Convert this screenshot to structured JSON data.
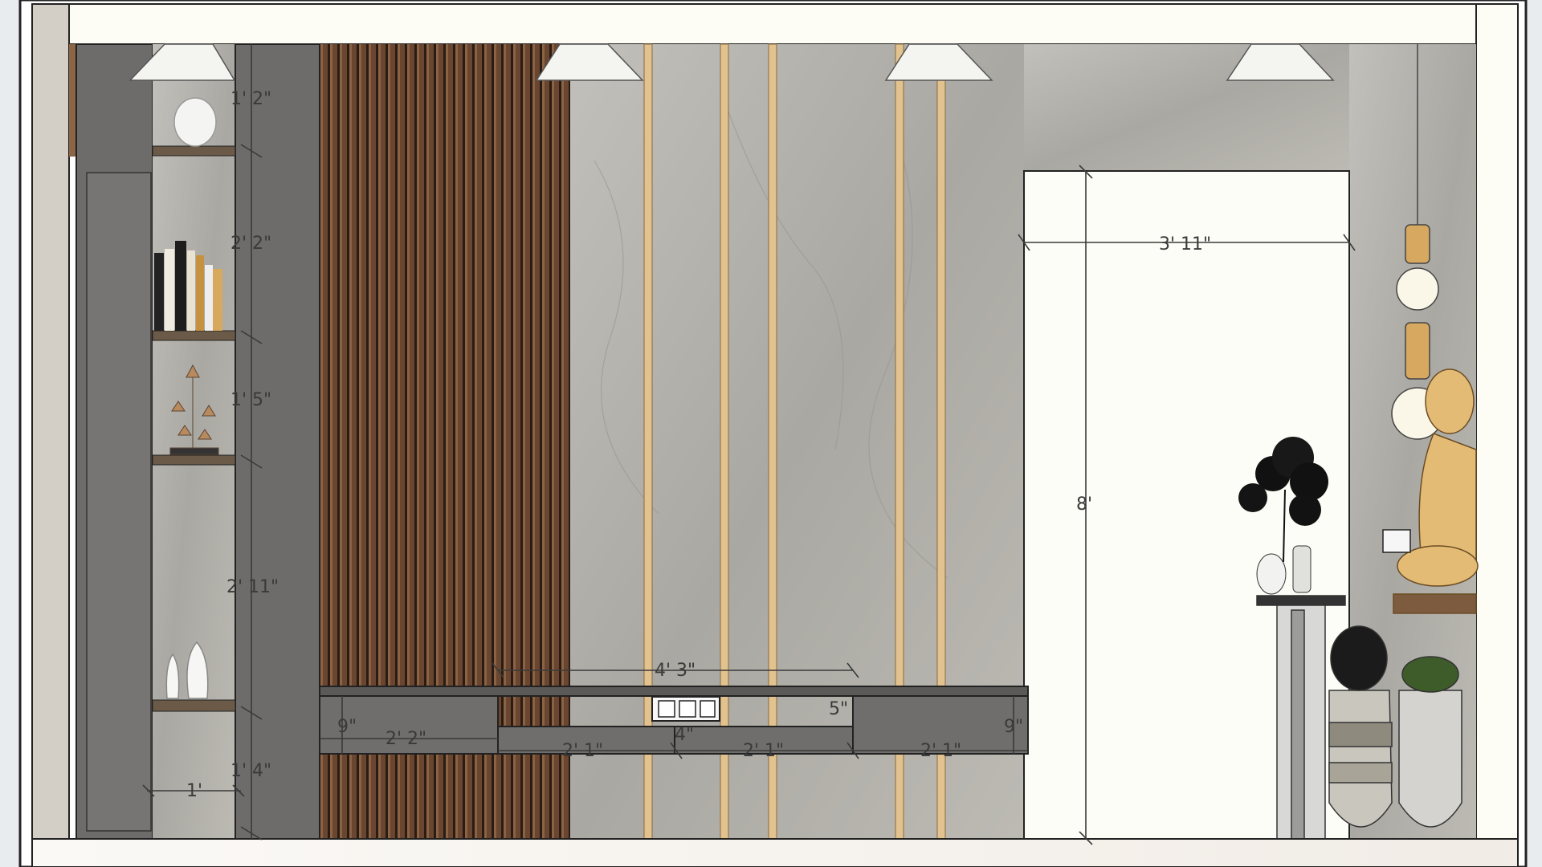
{
  "drawing": {
    "view": "elevation",
    "dimensions": {
      "niche_1": "1' 2\"",
      "niche_2": "2' 2\"",
      "niche_3": "1' 5\"",
      "niche_4": "2' 11\"",
      "niche_5": "1' 4\"",
      "shelf_width": "1'",
      "console_total": "4' 3\"",
      "console_left_height": "9\"",
      "console_left_drawer": "2' 2\"",
      "console_drawer_a": "2' 1\"",
      "console_drawer_b": "2' 1\"",
      "console_drawer_c": "2' 1\"",
      "console_mid_gap": "5\"",
      "console_mid_small": "4\"",
      "console_right_height": "9\"",
      "door_width": "3' 11\"",
      "door_height": "8'"
    },
    "colors": {
      "background": "#e9ecef",
      "marble": "#b6b4ae",
      "dark_panel": "#6d6c6a",
      "fluted_wood": "#5a3b28",
      "fluted_gap": "#2a1b12",
      "brass": "#d9b57a",
      "door": "#fdfdf7",
      "ceiling": "#fdfdf5"
    }
  }
}
